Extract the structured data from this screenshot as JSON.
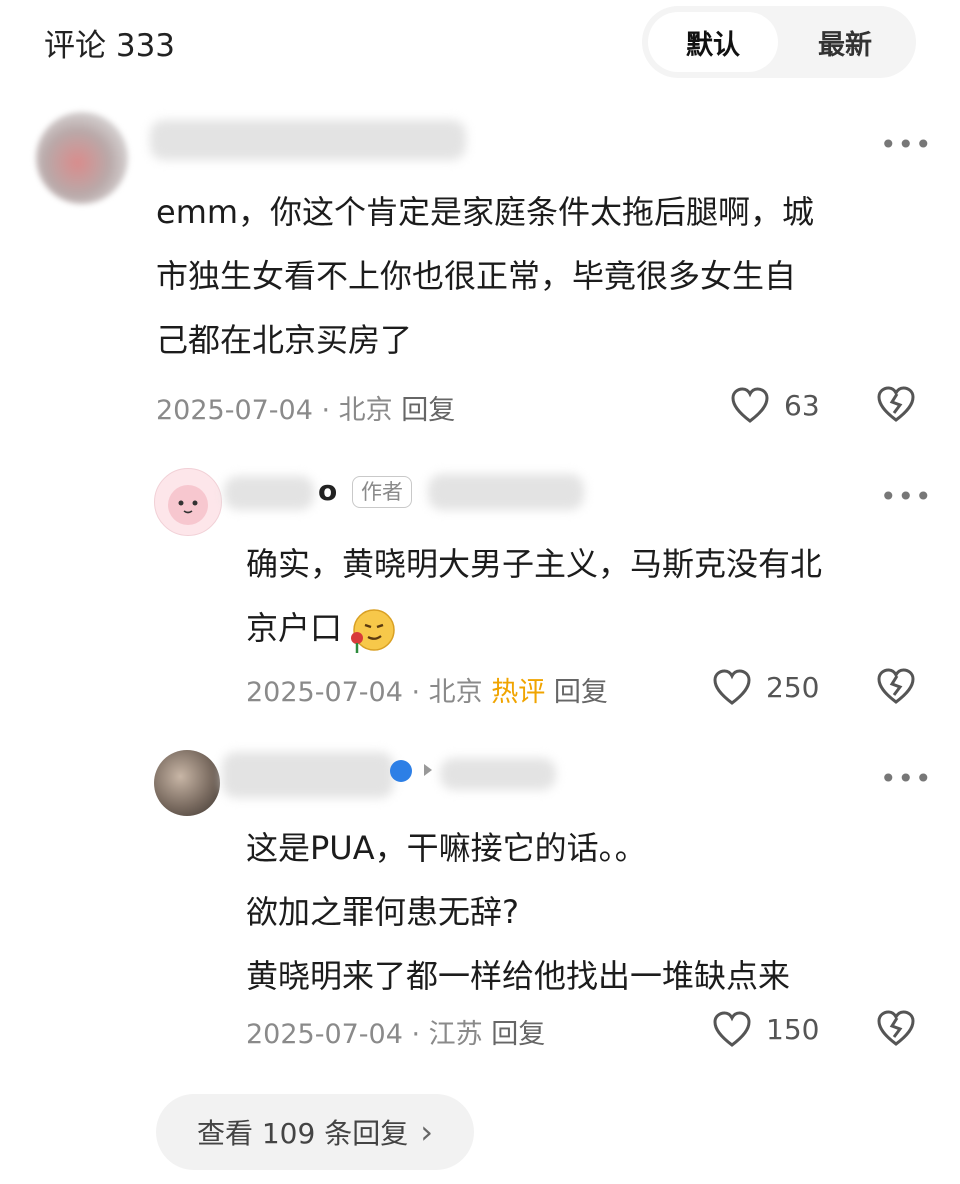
{
  "header": {
    "title": "评论 333"
  },
  "sort": {
    "default_label": "默认",
    "latest_label": "最新"
  },
  "comments": [
    {
      "lines": [
        "emm，你这个肯定是家庭条件太拖后腿啊，城",
        "市独生女看不上你也很正常，毕竟很多女生自",
        "己都在北京买房了"
      ],
      "date": "2025-07-04",
      "sep": " · ",
      "location": "北京",
      "reply_label": "回复",
      "likes": "63"
    },
    {
      "name_visible": "o",
      "author_tag": "作者",
      "lines": [
        "确实，黄晓明大男子主义，马斯克没有北",
        "京户口"
      ],
      "emoji": "🥀",
      "date": "2025-07-04",
      "sep": " · ",
      "location": "北京",
      "hot_label": "热评",
      "reply_label": "回复",
      "likes": "250"
    },
    {
      "lines": [
        "这是PUA，干嘛接它的话。。",
        "欲加之罪何患无辞?",
        "黄晓明来了都一样给他找出一堆缺点来"
      ],
      "date": "2025-07-04",
      "sep": " · ",
      "location": "江苏",
      "reply_label": "回复",
      "likes": "150"
    }
  ],
  "view_replies": {
    "label": "查看 109 条回复",
    "chevron": "›"
  },
  "icons": [
    "more-icon",
    "heart-icon",
    "broken-heart-icon",
    "chevron-right-icon"
  ],
  "colors": {
    "hot": "#f0a400",
    "meta": "#8a8a8a",
    "pill_bg": "#f2f2f2"
  }
}
